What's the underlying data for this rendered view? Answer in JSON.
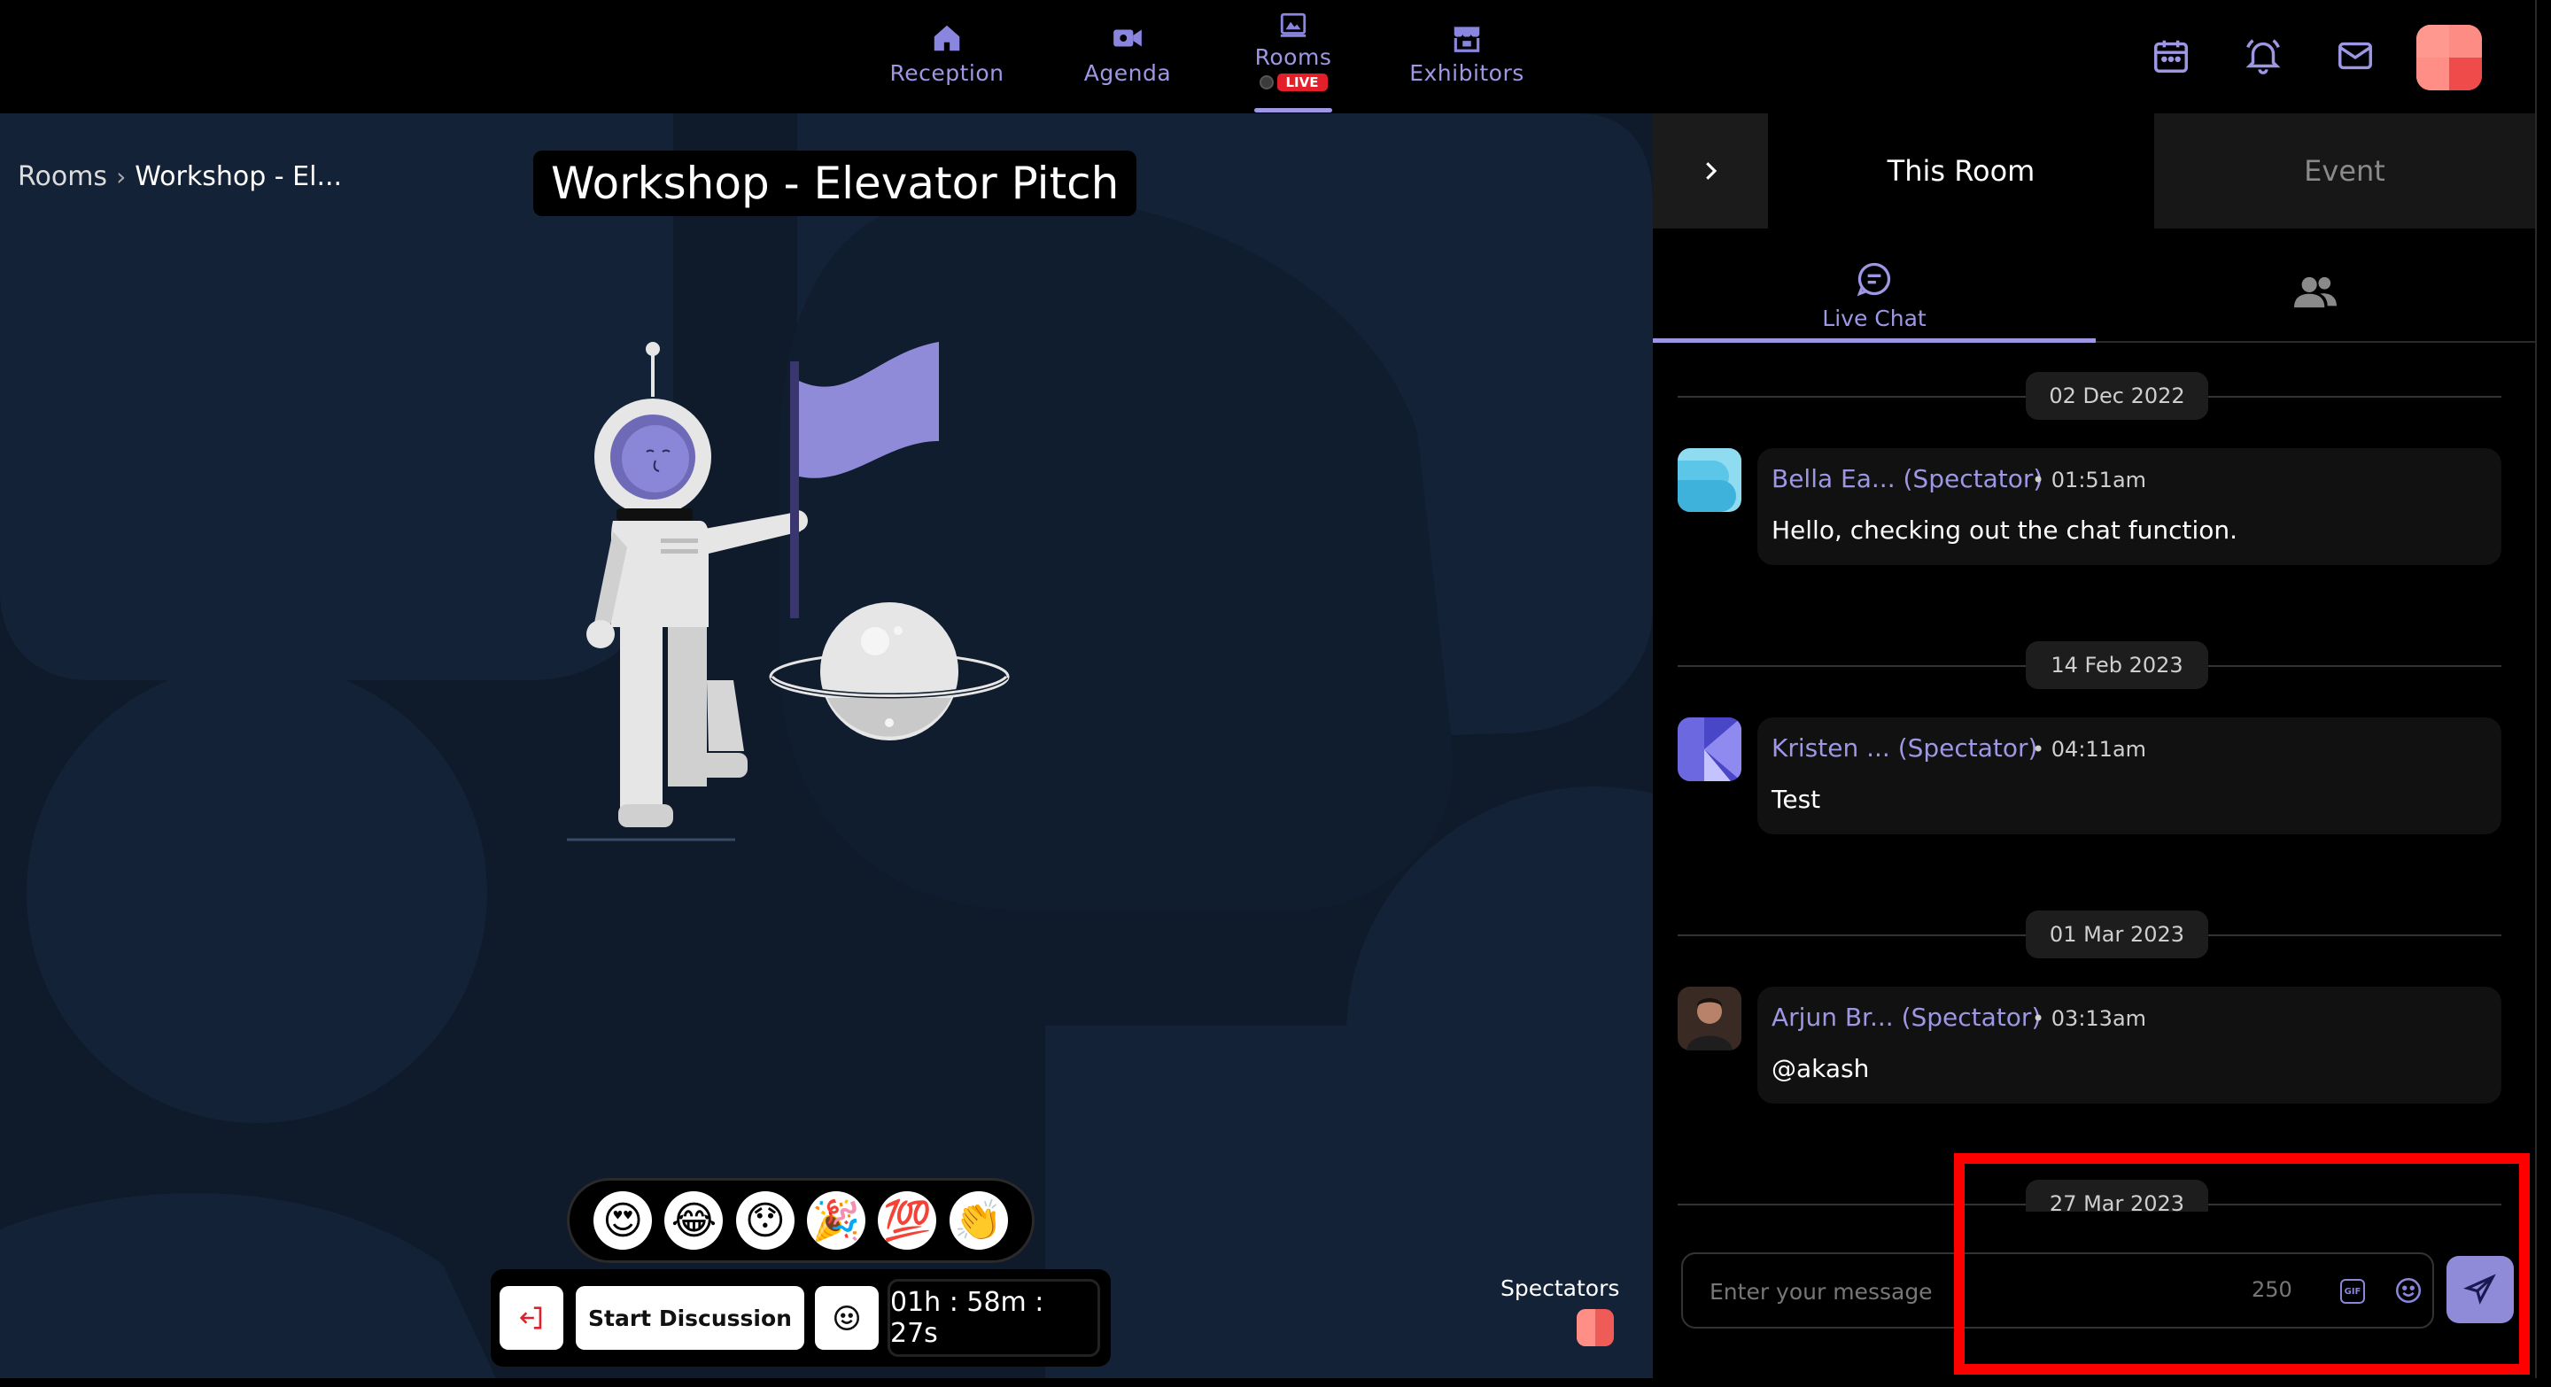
{
  "nav": {
    "items": [
      {
        "label": "Reception",
        "icon": "home-icon"
      },
      {
        "label": "Agenda",
        "icon": "video-icon"
      },
      {
        "label": "Rooms",
        "icon": "rooms-icon",
        "badge": "LIVE"
      },
      {
        "label": "Exhibitors",
        "icon": "store-icon"
      }
    ],
    "active": "Rooms",
    "accent_color": "#9d97e4",
    "right_icons": [
      "calendar-icon",
      "bell-icon",
      "mail-icon",
      "user-avatar"
    ]
  },
  "stage": {
    "breadcrumb": {
      "root": "Rooms",
      "current": "Workshop - El..."
    },
    "title": "Workshop - Elevator Pitch",
    "reactions": [
      "😍",
      "😂",
      "😯",
      "🎉",
      "💯",
      "👏"
    ],
    "controls": {
      "start_discussion": "Start Discussion",
      "timer": "01h : 58m : 27s"
    },
    "spectators_label": "Spectators"
  },
  "panel": {
    "tabs": [
      {
        "label": "This Room",
        "active": true
      },
      {
        "label": "Event",
        "active": false
      }
    ],
    "subtabs": {
      "chat_label": "Live Chat"
    },
    "dates": [
      "02 Dec 2022",
      "14 Feb 2023",
      "01 Mar 2023",
      "27 Mar 2023"
    ],
    "messages": [
      {
        "name": "Bella Ea... (Spectator)",
        "time": "• 01:51am",
        "text": "Hello, checking out the chat function."
      },
      {
        "name": "Kristen ... (Spectator)",
        "time": "• 04:11am",
        "text": "Test"
      },
      {
        "name": "Arjun Br... (Spectator)",
        "time": "• 03:13am",
        "text": "@akash"
      }
    ],
    "composer": {
      "placeholder": "Enter your message",
      "char_count": "250",
      "gif_label": "GIF"
    }
  },
  "colors": {
    "stage_bg": "#0f1a2a",
    "live_badge": "#e3202a",
    "highlight": "#ff0000"
  }
}
